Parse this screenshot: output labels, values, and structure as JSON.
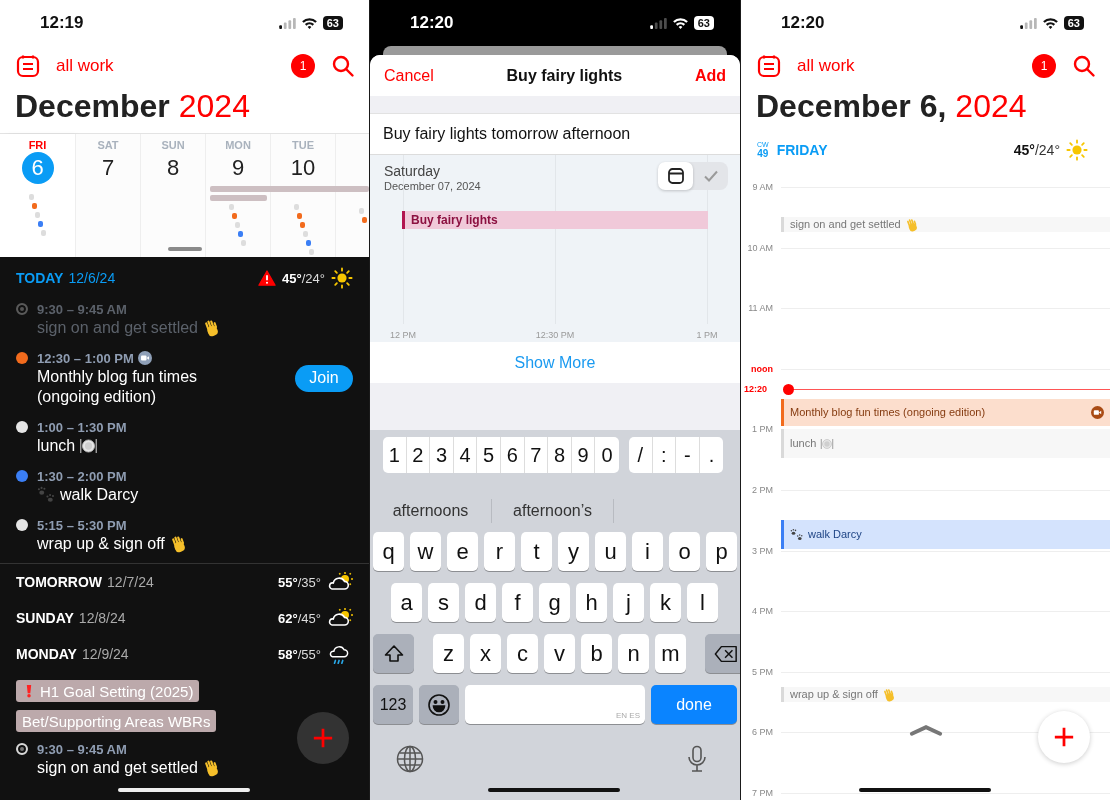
{
  "agenda_screen": {
    "status_bar": {
      "time": "12:19",
      "battery": "63"
    },
    "header": {
      "calendar_set": "all work",
      "notification_count": "1"
    },
    "title": {
      "month": "December",
      "year": "2024"
    },
    "week_strip": [
      {
        "weekday": "FRI",
        "date": "6",
        "selected": true,
        "dots": [
          {
            "color": "#dddddd"
          },
          {
            "color": "#f26b1d"
          },
          {
            "color": "#dddddd"
          },
          {
            "color": "#3b7ff5"
          },
          {
            "color": "#dddddd"
          }
        ]
      },
      {
        "weekday": "SAT",
        "date": "7",
        "selected": false
      },
      {
        "weekday": "SUN",
        "date": "8",
        "selected": false
      },
      {
        "weekday": "MON",
        "date": "9",
        "selected": false,
        "dots": [
          {
            "color": "#dddddd"
          },
          {
            "color": "#f26b1d"
          },
          {
            "color": "#dddddd"
          },
          {
            "color": "#3b7ff5"
          },
          {
            "color": "#dddddd"
          }
        ]
      },
      {
        "weekday": "TUE",
        "date": "10",
        "selected": false,
        "dots": [
          {
            "color": "#dddddd"
          },
          {
            "color": "#f26b1d"
          },
          {
            "color": "#f26b1d"
          },
          {
            "color": "#dddddd"
          },
          {
            "color": "#3b7ff5"
          },
          {
            "color": "#dddddd"
          }
        ]
      },
      {
        "selected": false,
        "dots": [
          {
            "color": "#dddddd"
          },
          {
            "color": "#f26b1d"
          }
        ]
      }
    ],
    "today": {
      "label": "TODAY",
      "date": "12/6/24",
      "alert": true,
      "temps": "**45°**/24°",
      "weather": {
        "kind": "sunny"
      },
      "events": [
        {
          "time": "9:30 – 9:45 AM",
          "title": "sign on and get settled",
          "ring": true,
          "color": "#5a5a5a",
          "past": true,
          "trailing_icon": {
            "kind": "wave"
          }
        },
        {
          "time": "12:30 – 1:00 PM",
          "title": "Monthly blog fun times (ongoing edition)",
          "ring": false,
          "color": "#f26b1d",
          "past": false,
          "video": true,
          "action": "Join"
        },
        {
          "time": "1:00 – 1:30 PM",
          "title": "lunch",
          "ring": false,
          "color": "#e5e5e5",
          "past": false,
          "trailing_icon": {
            "kind": "plate"
          }
        },
        {
          "time": "1:30 – 2:00 PM",
          "title": "walk Darcy",
          "ring": false,
          "color": "#3b7ff5",
          "past": false,
          "leading_icon": {
            "kind": "paw"
          }
        },
        {
          "time": "5:15 – 5:30 PM",
          "title": "wrap up & sign off",
          "ring": false,
          "color": "#e5e5e5",
          "past": false,
          "trailing_icon": {
            "kind": "wave"
          }
        }
      ]
    },
    "upcoming_days": [
      {
        "label": "TOMORROW",
        "date": "12/7/24",
        "temps": "**55°**/35°",
        "weather": {
          "kind": "partly_cloudy"
        }
      },
      {
        "label": "SUNDAY",
        "date": "12/8/24",
        "temps": "**62°**/45°",
        "weather": {
          "kind": "partly_cloudy"
        }
      },
      {
        "label": "MONDAY",
        "date": "12/9/24",
        "temps": "**58°**/55°",
        "weather": {
          "kind": "rain"
        },
        "all_day_events": [
          {
            "title": "H1 Goal Setting (2025)",
            "important": true
          },
          {
            "title": "Bet/Supporting Areas WBRs",
            "important": false
          }
        ],
        "events": [
          {
            "time": "9:30 – 9:45 AM",
            "title": "sign on and get settled",
            "ring": true,
            "color": "#d8d8d8",
            "past": false,
            "trailing_icon": {
              "kind": "wave"
            }
          }
        ]
      }
    ]
  },
  "quick_add_screen": {
    "status_bar": {
      "time": "12:20",
      "battery": "63"
    },
    "nav": {
      "cancel": "Cancel",
      "title": "Buy fairy lights",
      "confirm": "Add"
    },
    "input": {
      "value": "Buy fairy lights tomorrow afternoon"
    },
    "preview": {
      "day": "Saturday",
      "date": "December 07, 2024",
      "event": "Buy fairy lights",
      "time_ticks": [
        "12 PM",
        "12:30 PM",
        "1 PM"
      ],
      "mode_toggle": [
        {
          "kind": "calendar",
          "selected": true
        },
        {
          "kind": "check",
          "selected": false
        }
      ]
    },
    "show_more": "Show More",
    "keyboard": {
      "number_keys": [
        "1",
        "2",
        "3",
        "4",
        "5",
        "6",
        "7",
        "8",
        "9",
        "0"
      ],
      "symbol_keys": [
        "/",
        ":",
        "-",
        "."
      ],
      "suggestions": [
        "afternoons",
        "afternoon’s"
      ],
      "letter_rows": [
        [
          "q",
          "w",
          "e",
          "r",
          "t",
          "y",
          "u",
          "i",
          "o",
          "p"
        ],
        [
          "a",
          "s",
          "d",
          "f",
          "g",
          "h",
          "j",
          "k",
          "l"
        ],
        [
          "z",
          "x",
          "c",
          "v",
          "b",
          "n",
          "m"
        ]
      ],
      "mode_key": "123",
      "space_languages": "EN ES",
      "return_key": "done"
    }
  },
  "day_screen": {
    "status_bar": {
      "time": "12:20",
      "battery": "63"
    },
    "header": {
      "calendar_set": "all work",
      "notification_count": "1"
    },
    "title": {
      "date": "December 6,",
      "year": "2024"
    },
    "day_header": {
      "week_label": "CW",
      "week_number": "49",
      "weekday": "FRIDAY",
      "temps": "**45°**/24°",
      "weather": {
        "kind": "sunny"
      }
    },
    "hours": [
      {
        "label": "9 AM",
        "highlight": false
      },
      {
        "label": "10 AM",
        "highlight": false
      },
      {
        "label": "11 AM",
        "highlight": false
      },
      {
        "label": "noon",
        "highlight": true
      },
      {
        "label": "1 PM",
        "highlight": false
      },
      {
        "label": "2 PM",
        "highlight": false
      },
      {
        "label": "3 PM",
        "highlight": false
      },
      {
        "label": "4 PM",
        "highlight": false
      },
      {
        "label": "5 PM",
        "highlight": false
      },
      {
        "label": "6 PM",
        "highlight": false
      },
      {
        "label": "7 PM",
        "highlight": false
      }
    ],
    "now": "12:20",
    "events": [
      {
        "title": "sign on and get settled",
        "color": "#d9d9d9",
        "trailing_icon": {
          "kind": "wave"
        }
      },
      {
        "title": "Monthly blog fun times (ongoing edition)",
        "color": "#f26b1d",
        "video": true
      },
      {
        "title": "lunch",
        "color": "#d9d9d9",
        "trailing_icon": {
          "kind": "plate"
        }
      },
      {
        "title": "walk Darcy",
        "color": "#3b7ff5",
        "leading_icon": {
          "kind": "paw"
        }
      },
      {
        "title": "wrap up & sign off",
        "color": "#d9d9d9",
        "trailing_icon": {
          "kind": "wave"
        }
      }
    ]
  }
}
